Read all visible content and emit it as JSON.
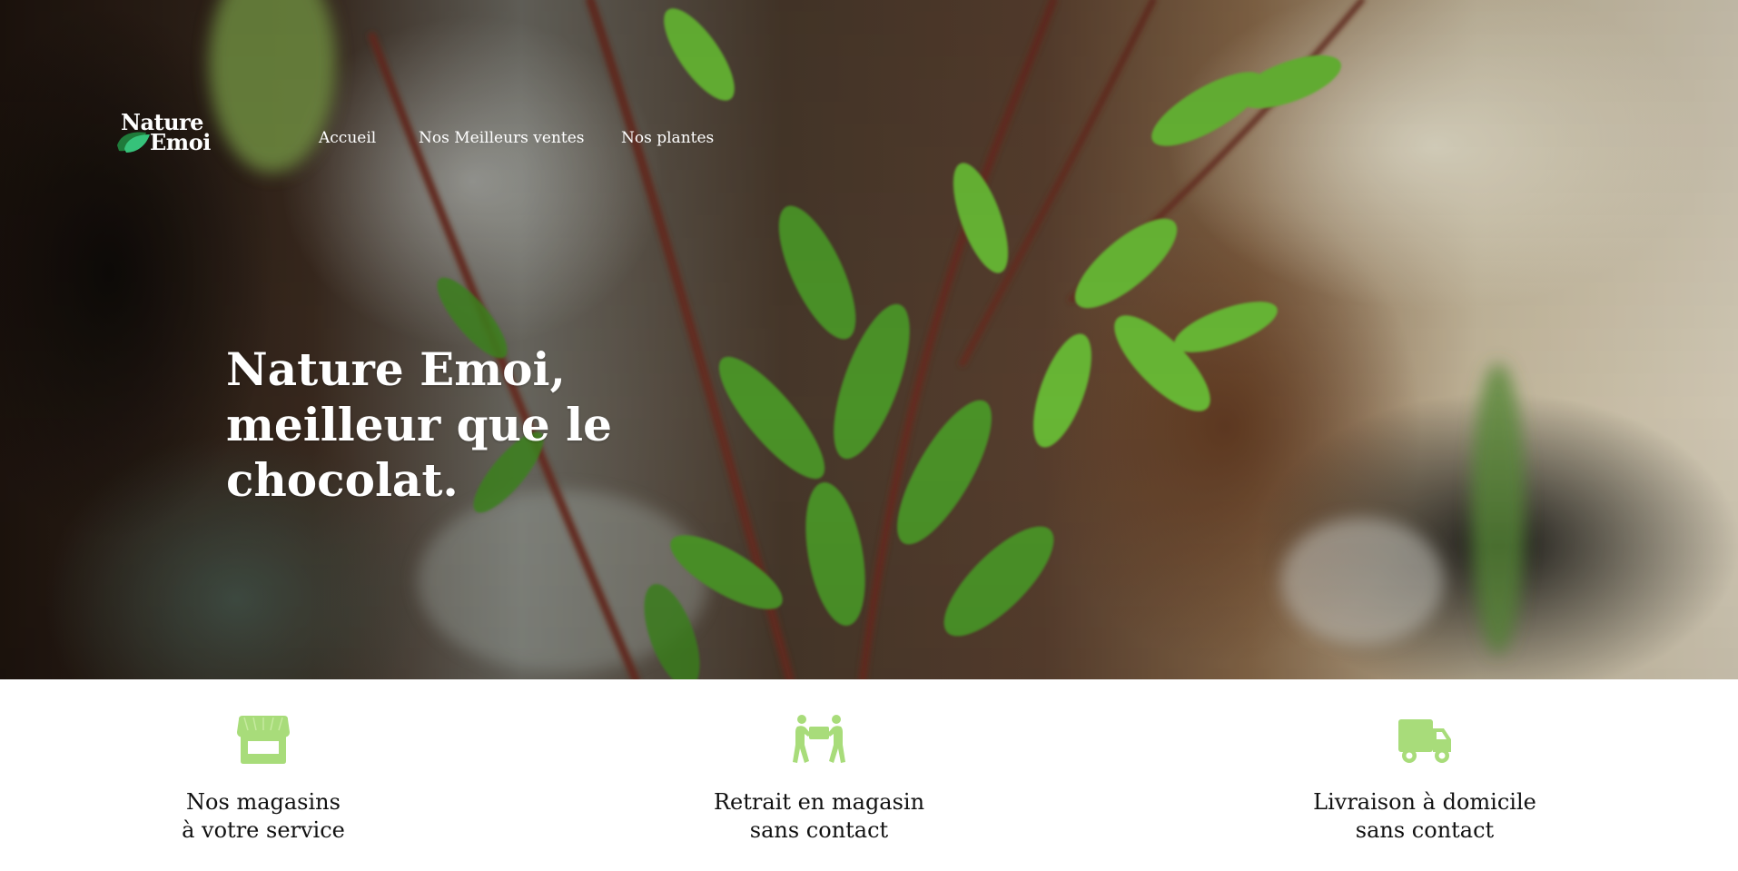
{
  "brand": {
    "logo_line1": "Nature",
    "logo_line2": "Emoi",
    "accent_color": "#a8dc7a",
    "leaf_dark": "#1f7a3a",
    "leaf_light": "#36c27a"
  },
  "nav": {
    "items": [
      {
        "label": "Accueil"
      },
      {
        "label": "Nos Meilleurs ventes"
      },
      {
        "label": "Nos plantes"
      }
    ]
  },
  "hero": {
    "headline": "Nature Emoi, meilleur que le chocolat."
  },
  "features": [
    {
      "icon": "store-icon",
      "line1": "Nos magasins",
      "line2": "à votre service"
    },
    {
      "icon": "people-carrying-box-icon",
      "line1": "Retrait en magasin",
      "line2": "sans contact"
    },
    {
      "icon": "delivery-truck-icon",
      "line1": "Livraison à domicile",
      "line2": "sans contact"
    }
  ]
}
